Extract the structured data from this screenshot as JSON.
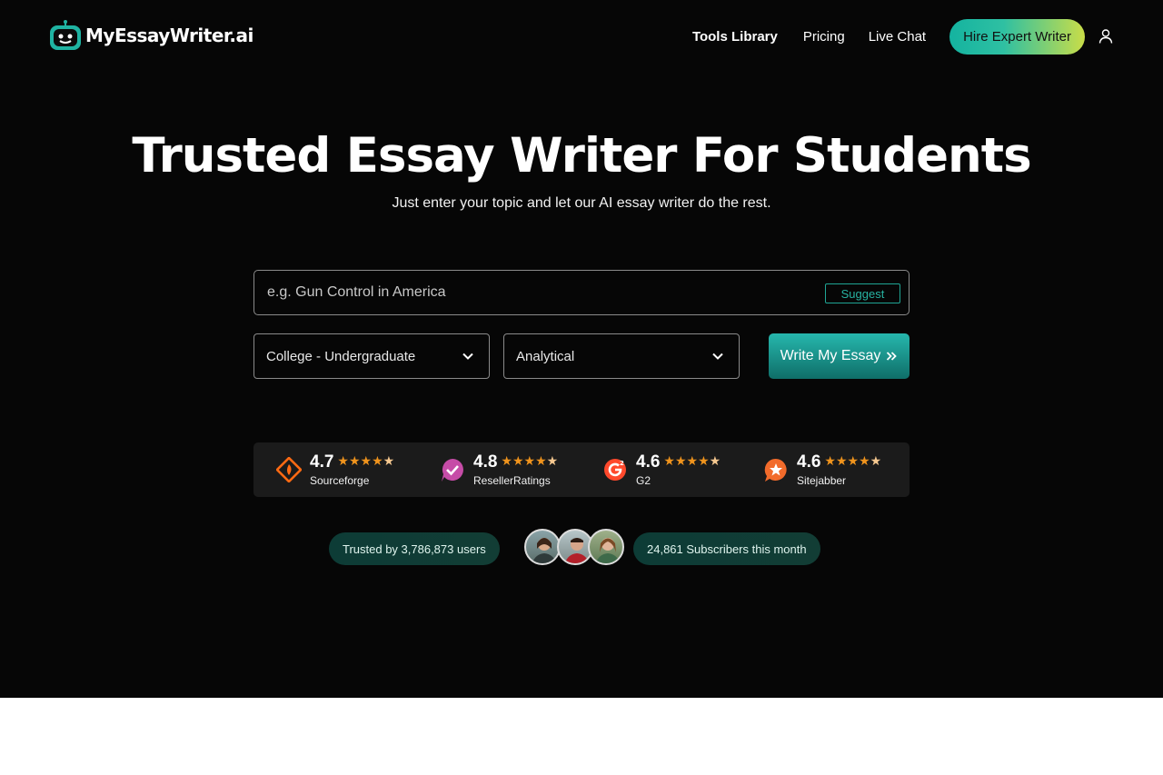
{
  "logo": {
    "text": "MyEssayWriter.ai"
  },
  "nav": {
    "items": [
      "Tools Library",
      "Pricing",
      "Live Chat"
    ],
    "cta": "Hire Expert Writer"
  },
  "hero": {
    "title": "Trusted Essay Writer For Students",
    "subtitle": "Just enter your topic and let our AI essay writer do the rest."
  },
  "form": {
    "topic_placeholder": "e.g. Gun Control in America",
    "suggest_label": "Suggest",
    "level_value": "College - Undergraduate",
    "type_value": "Analytical",
    "submit_label": "Write My Essay"
  },
  "ratings": [
    {
      "score": "4.7",
      "name": "Sourceforge",
      "stars": 4.7,
      "brand_color": "#ff6a13"
    },
    {
      "score": "4.8",
      "name": "ResellerRatings",
      "stars": 4.8,
      "brand_color": "#c64ca7"
    },
    {
      "score": "4.6",
      "name": "G2",
      "stars": 4.6,
      "brand_color": "#ff492c"
    },
    {
      "score": "4.6",
      "name": "Sitejabber",
      "stars": 4.6,
      "brand_color": "#f26b2b"
    }
  ],
  "trust": {
    "users": "Trusted by 3,786,873 users",
    "subscribers": "24,861 Subscribers this month"
  },
  "colors": {
    "accent": "#1fb3a2",
    "hero_bg": "#060606",
    "star": "#f0941d"
  }
}
